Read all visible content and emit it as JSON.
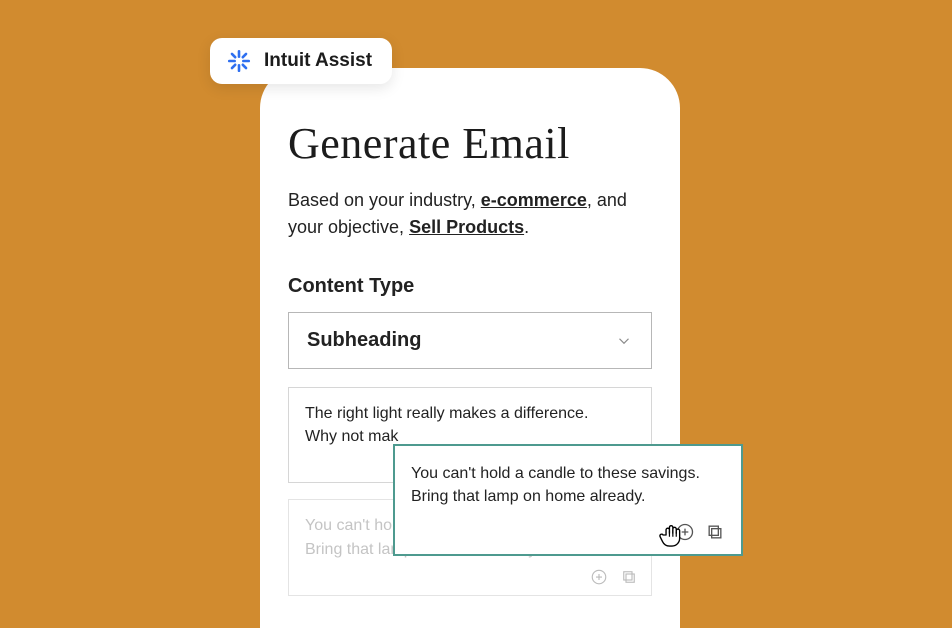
{
  "badge": {
    "label": "Intuit Assist"
  },
  "page": {
    "title": "Generate Email",
    "subtitle_prefix": "Based on your industry, ",
    "subtitle_industry": "e-commerce",
    "subtitle_mid": ", and your objective, ",
    "subtitle_objective": "Sell Products",
    "subtitle_suffix": "."
  },
  "content_type": {
    "label": "Content Type",
    "selected": "Subheading"
  },
  "options": [
    {
      "text_line1": "The right light really makes a difference.",
      "text_line2": "Why not mak"
    },
    {
      "text_line1": "You can't ho",
      "text_line2": "Bring that lamp on home already."
    }
  ],
  "tooltip": {
    "line1": "You can't hold a candle to these savings.",
    "line2": "Bring that lamp on home already."
  }
}
